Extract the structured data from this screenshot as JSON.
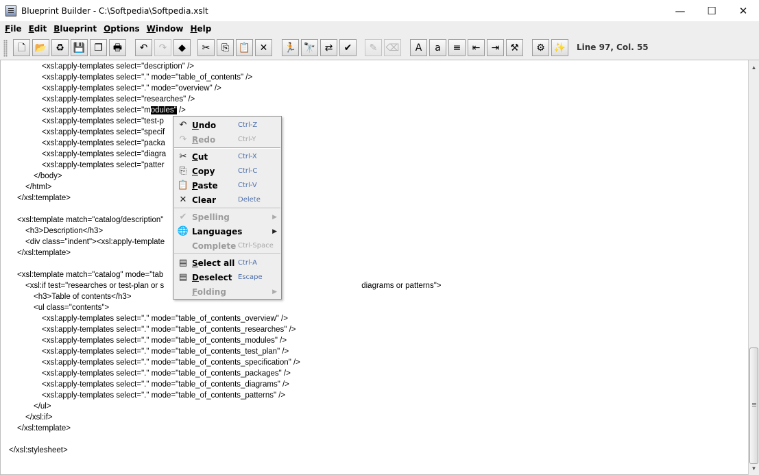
{
  "window": {
    "title": "Blueprint Builder - C:\\Softpedia\\Softpedia.xslt",
    "minimize_glyph": "—",
    "maximize_glyph": "☐",
    "close_glyph": "✕"
  },
  "menu": [
    {
      "mnemonic": "F",
      "rest": "ile"
    },
    {
      "mnemonic": "E",
      "rest": "dit"
    },
    {
      "mnemonic": "B",
      "rest": "lueprint"
    },
    {
      "mnemonic": "O",
      "rest": "ptions"
    },
    {
      "mnemonic": "W",
      "rest": "indow"
    },
    {
      "mnemonic": "H",
      "rest": "elp"
    }
  ],
  "toolbar": {
    "status": "Line 97, Col. 55",
    "buttons": [
      {
        "name": "new-document-icon",
        "glyph": "🗋",
        "enabled": true
      },
      {
        "name": "open-folder-icon",
        "glyph": "📂",
        "enabled": true
      },
      {
        "name": "recycle-icon",
        "glyph": "♻",
        "enabled": true
      },
      {
        "name": "save-icon",
        "glyph": "💾",
        "enabled": true
      },
      {
        "name": "save-all-icon",
        "glyph": "❐",
        "enabled": true
      },
      {
        "name": "print-icon",
        "glyph": "🖶",
        "enabled": true
      },
      {
        "name": "undo-icon",
        "glyph": "↶",
        "enabled": true
      },
      {
        "name": "redo-icon",
        "glyph": "↷",
        "enabled": false
      },
      {
        "name": "run-icon",
        "glyph": "◆",
        "enabled": true
      },
      {
        "name": "cut-icon",
        "glyph": "✂",
        "enabled": true
      },
      {
        "name": "copy-icon",
        "glyph": "⎘",
        "enabled": true
      },
      {
        "name": "paste-icon",
        "glyph": "📋",
        "enabled": true
      },
      {
        "name": "clear-icon",
        "glyph": "✕",
        "enabled": true
      },
      {
        "name": "goto-icon",
        "glyph": "🏃",
        "enabled": true
      },
      {
        "name": "find-icon",
        "glyph": "🔭",
        "enabled": true
      },
      {
        "name": "replace-icon",
        "glyph": "⇄",
        "enabled": true
      },
      {
        "name": "spellcheck-icon",
        "glyph": "✔",
        "enabled": true
      },
      {
        "name": "comment-icon",
        "glyph": "✎",
        "enabled": false
      },
      {
        "name": "uncomment-icon",
        "glyph": "⌫",
        "enabled": false
      },
      {
        "name": "uppercase-icon",
        "glyph": "A",
        "enabled": true
      },
      {
        "name": "lowercase-icon",
        "glyph": "a",
        "enabled": true
      },
      {
        "name": "align-left-icon",
        "glyph": "≡",
        "enabled": true
      },
      {
        "name": "indent-decrease-icon",
        "glyph": "⇤",
        "enabled": true
      },
      {
        "name": "indent-increase-icon",
        "glyph": "⇥",
        "enabled": true
      },
      {
        "name": "tools-icon",
        "glyph": "⚒",
        "enabled": true
      },
      {
        "name": "settings-icon",
        "glyph": "⚙",
        "enabled": true
      },
      {
        "name": "magic-wand-icon",
        "glyph": "✨",
        "enabled": true
      }
    ]
  },
  "colors": {
    "accent_shortcut": "#4e6fa8",
    "selection_bg": "#000000",
    "chrome": "#eeeeee"
  },
  "editor": {
    "lines": [
      {
        "indent": 60,
        "text": "<xsl:apply-templates select=\"description\" />"
      },
      {
        "indent": 60,
        "text": "<xsl:apply-templates select=\".\" mode=\"table_of_contents\" />"
      },
      {
        "indent": 60,
        "text": "<xsl:apply-templates select=\".\" mode=\"overview\" />"
      },
      {
        "indent": 60,
        "text": "<xsl:apply-templates select=\"researches\" />"
      },
      {
        "indent": 60,
        "pre": "<xsl:apply-templates select=\"m",
        "sel": "odules\"",
        "post": " />"
      },
      {
        "indent": 60,
        "text": "<xsl:apply-templates select=\"test-p"
      },
      {
        "indent": 60,
        "text": "<xsl:apply-templates select=\"specif"
      },
      {
        "indent": 60,
        "text": "<xsl:apply-templates select=\"packa"
      },
      {
        "indent": 60,
        "text": "<xsl:apply-templates select=\"diagra"
      },
      {
        "indent": 60,
        "text": "<xsl:apply-templates select=\"patter"
      },
      {
        "indent": 48,
        "text": "</body>"
      },
      {
        "indent": 36,
        "text": "</html>"
      },
      {
        "indent": 24,
        "text": "</xsl:template>"
      },
      {
        "indent": 24,
        "text": ""
      },
      {
        "indent": 24,
        "text": "<xsl:template match=\"catalog/description\""
      },
      {
        "indent": 36,
        "text": "<h3>Description</h3>"
      },
      {
        "indent": 36,
        "text": "<div class=\"indent\"><xsl:apply-template"
      },
      {
        "indent": 24,
        "text": "</xsl:template>"
      },
      {
        "indent": 24,
        "text": ""
      },
      {
        "indent": 24,
        "text": "<xsl:template match=\"catalog\" mode=\"tab"
      },
      {
        "indent": 36,
        "pre": "<xsl:if test=\"researches or test-plan or s",
        "gap": 288,
        "post": "diagrams or patterns\">"
      },
      {
        "indent": 48,
        "text": "<h3>Table of contents</h3>"
      },
      {
        "indent": 48,
        "text": "<ul class=\"contents\">"
      },
      {
        "indent": 60,
        "text": "<xsl:apply-templates select=\".\" mode=\"table_of_contents_overview\" />"
      },
      {
        "indent": 60,
        "text": "<xsl:apply-templates select=\".\" mode=\"table_of_contents_researches\" />"
      },
      {
        "indent": 60,
        "text": "<xsl:apply-templates select=\".\" mode=\"table_of_contents_modules\" />"
      },
      {
        "indent": 60,
        "text": "<xsl:apply-templates select=\".\" mode=\"table_of_contents_test_plan\" />"
      },
      {
        "indent": 60,
        "text": "<xsl:apply-templates select=\".\" mode=\"table_of_contents_specification\" />"
      },
      {
        "indent": 60,
        "text": "<xsl:apply-templates select=\".\" mode=\"table_of_contents_packages\" />"
      },
      {
        "indent": 60,
        "text": "<xsl:apply-templates select=\".\" mode=\"table_of_contents_diagrams\" />"
      },
      {
        "indent": 60,
        "text": "<xsl:apply-templates select=\".\" mode=\"table_of_contents_patterns\" />"
      },
      {
        "indent": 48,
        "text": "</ul>"
      },
      {
        "indent": 36,
        "text": "</xsl:if>"
      },
      {
        "indent": 24,
        "text": "</xsl:template>"
      },
      {
        "indent": 24,
        "text": ""
      },
      {
        "indent": 12,
        "text": "</xsl:stylesheet>"
      }
    ]
  },
  "context_menu": {
    "groups": [
      [
        {
          "name": "undo",
          "icon": "↶",
          "mnemonic": "U",
          "rest": "ndo",
          "shortcut": "Ctrl-Z",
          "enabled": true
        },
        {
          "name": "redo",
          "icon": "↷",
          "mnemonic": "R",
          "rest": "edo",
          "shortcut": "Ctrl-Y",
          "enabled": false
        }
      ],
      [
        {
          "name": "cut",
          "icon": "✂",
          "mnemonic": "C",
          "rest": "ut",
          "shortcut": "Ctrl-X",
          "enabled": true
        },
        {
          "name": "copy",
          "icon": "⎘",
          "mnemonic": "C",
          "rest": "opy",
          "shortcut": "Ctrl-C",
          "enabled": true
        },
        {
          "name": "paste",
          "icon": "📋",
          "mnemonic": "P",
          "rest": "aste",
          "shortcut": "Ctrl-V",
          "enabled": true
        },
        {
          "name": "clear",
          "icon": "✕",
          "mnemonic": "",
          "rest": "Clear",
          "mid": "C",
          "shortcut": "Delete",
          "enabled": true
        }
      ],
      [
        {
          "name": "spelling",
          "icon": "✔",
          "mnemonic": "",
          "rest": "Spelling",
          "shortcut": "",
          "enabled": false,
          "submenu": true
        },
        {
          "name": "languages",
          "icon": "🌐",
          "mnemonic": "",
          "rest": "Languages",
          "shortcut": "",
          "enabled": true,
          "submenu": true
        },
        {
          "name": "complete",
          "icon": "",
          "mnemonic": "",
          "rest": "Complete",
          "shortcut": "Ctrl-Space",
          "enabled": false
        }
      ],
      [
        {
          "name": "select-all",
          "icon": "▤",
          "mnemonic": "S",
          "rest": "elect all",
          "shortcut": "Ctrl-A",
          "enabled": true
        },
        {
          "name": "deselect",
          "icon": "▤",
          "mnemonic": "D",
          "rest": "eselect",
          "shortcut": "Escape",
          "enabled": true
        },
        {
          "name": "folding",
          "icon": "",
          "mnemonic": "F",
          "rest": "olding",
          "shortcut": "",
          "enabled": false,
          "submenu": true
        }
      ]
    ]
  }
}
